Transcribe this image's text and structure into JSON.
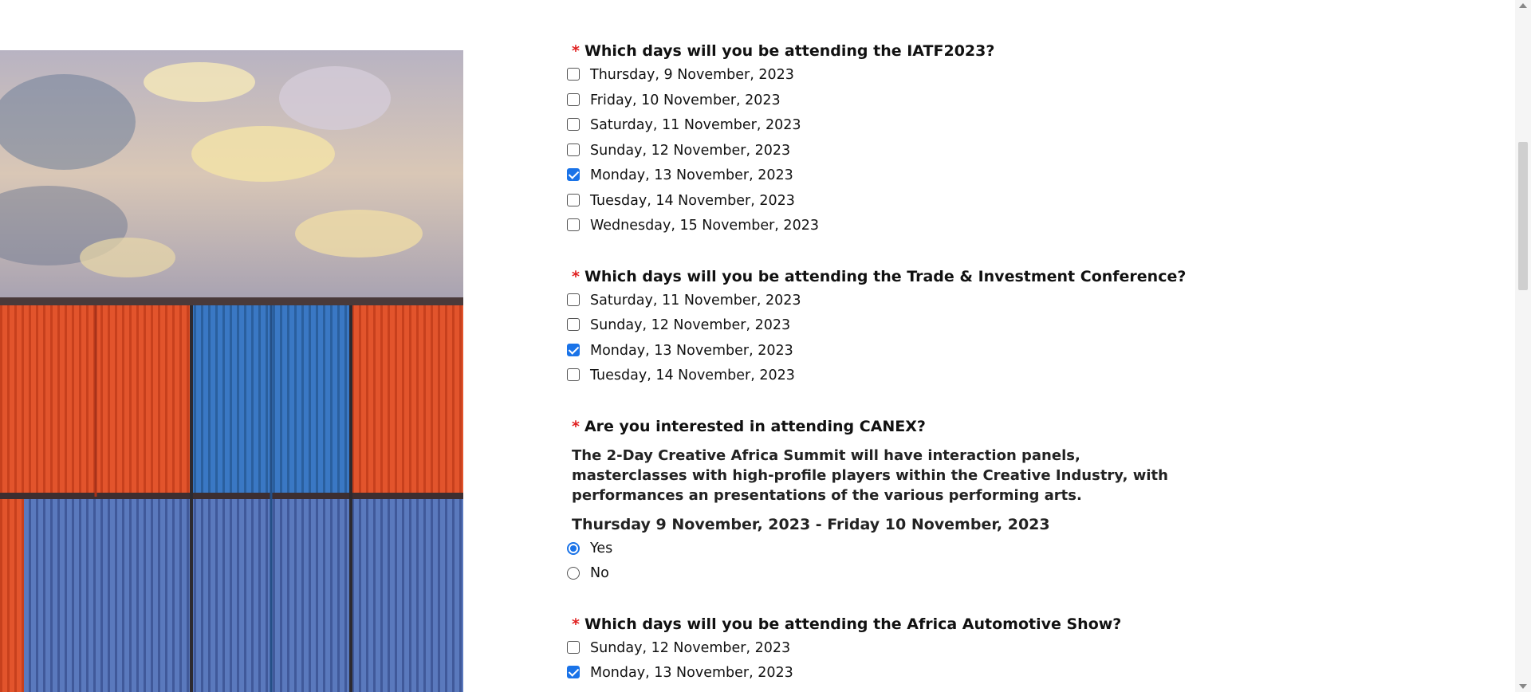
{
  "colors": {
    "required_asterisk": "#e02020",
    "checkbox_checked": "#1a73e8",
    "text": "#111111"
  },
  "hero_image": {
    "description_icon": "shipping-containers-image"
  },
  "questions": {
    "iatf": {
      "required_mark": "*",
      "title": "Which days will you be attending the IATF2023?",
      "options": [
        {
          "label": "Thursday, 9 November, 2023",
          "checked": false
        },
        {
          "label": "Friday, 10 November, 2023",
          "checked": false
        },
        {
          "label": "Saturday, 11 November, 2023",
          "checked": false
        },
        {
          "label": "Sunday, 12 November, 2023",
          "checked": false
        },
        {
          "label": "Monday, 13 November, 2023",
          "checked": true
        },
        {
          "label": "Tuesday, 14 November, 2023",
          "checked": false
        },
        {
          "label": "Wednesday, 15 November, 2023",
          "checked": false
        }
      ]
    },
    "trade": {
      "required_mark": "*",
      "title": "Which days will you be attending the Trade & Investment Conference?",
      "options": [
        {
          "label": "Saturday, 11 November, 2023",
          "checked": false
        },
        {
          "label": "Sunday, 12 November, 2023",
          "checked": false
        },
        {
          "label": "Monday, 13 November, 2023",
          "checked": true
        },
        {
          "label": "Tuesday, 14 November, 2023",
          "checked": false
        }
      ]
    },
    "canex": {
      "required_mark": "*",
      "title": "Are you interested in attending CANEX?",
      "description": "The 2-Day Creative Africa Summit will have interaction panels, masterclasses with high-profile players within the Creative Industry, with performances an presentations of the various performing arts.",
      "dates": "Thursday 9 November, 2023 - Friday 10 November, 2023",
      "options": [
        {
          "label": "Yes",
          "checked": true
        },
        {
          "label": "No",
          "checked": false
        }
      ]
    },
    "automotive": {
      "required_mark": "*",
      "title": "Which days will you be attending the Africa Automotive Show?",
      "options": [
        {
          "label": "Sunday, 12 November, 2023",
          "checked": false
        },
        {
          "label": "Monday, 13 November, 2023",
          "checked": true
        }
      ]
    }
  }
}
